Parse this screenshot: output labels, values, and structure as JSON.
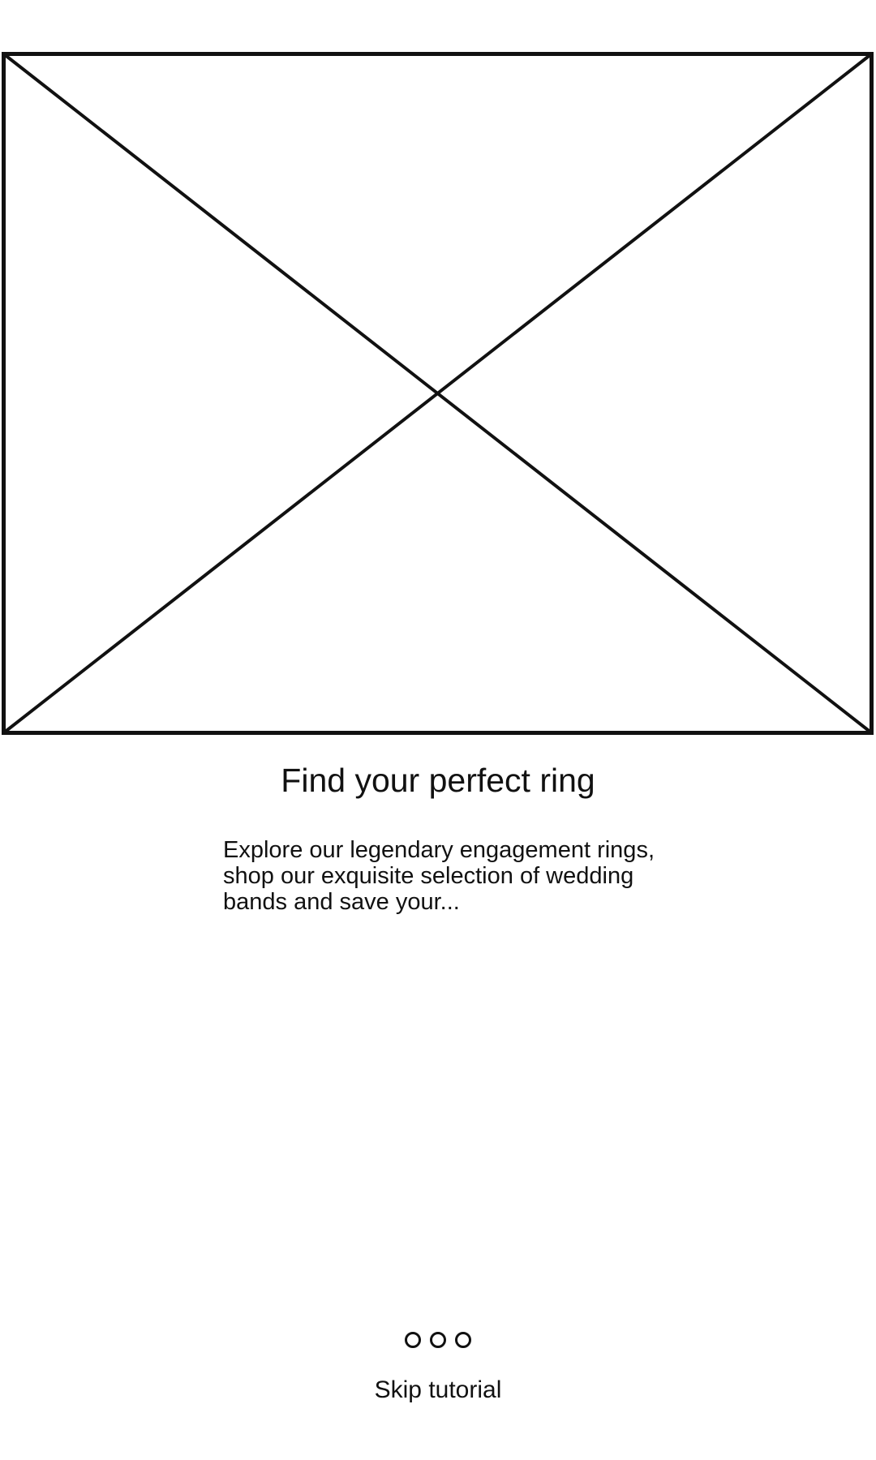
{
  "onboarding": {
    "hero_image_icon": "image-placeholder-icon",
    "title": "Find your perfect ring",
    "description": "Explore our legendary engagement rings, shop our exquisite selection of wedding bands and save your...",
    "pager": {
      "total_pages": 3
    },
    "skip_label": "Skip tutorial"
  },
  "colors": {
    "background": "#ffffff",
    "foreground": "#111111"
  }
}
